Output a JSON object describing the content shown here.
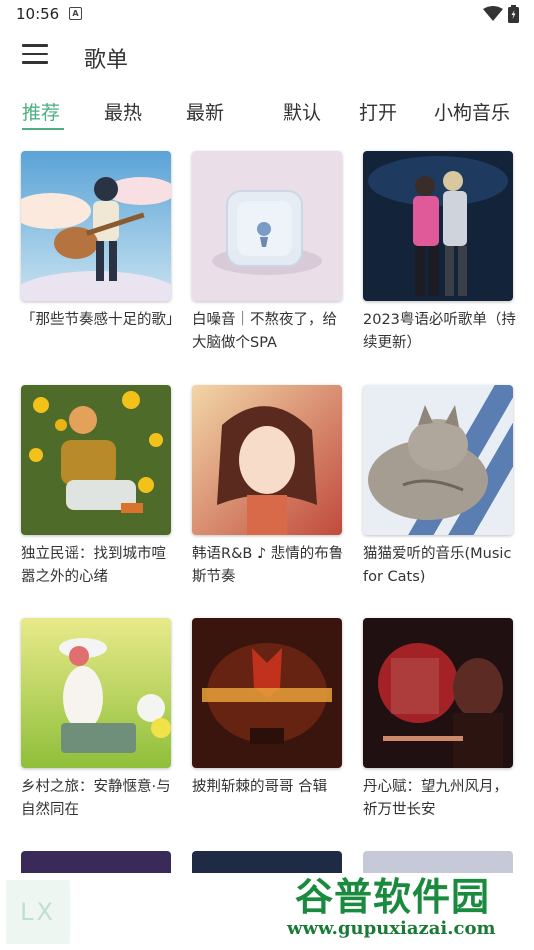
{
  "status": {
    "time": "10:56",
    "notif_icon": "A"
  },
  "header": {
    "title": "歌单"
  },
  "tabs": [
    {
      "label": "推荐"
    },
    {
      "label": "最热"
    },
    {
      "label": "最新"
    },
    {
      "label": "默认"
    },
    {
      "label": "打开"
    },
    {
      "label": "小枸音乐"
    }
  ],
  "playlists": [
    {
      "title": "「那些节奏感十足的歌」",
      "cover": "anime-guitar-girl"
    },
    {
      "title": "白噪音｜不熬夜了，给大脑做个SPA",
      "cover": "ice-cube"
    },
    {
      "title": "2023粤语必听歌单（持续更新）",
      "cover": "concert-stage"
    },
    {
      "title": "独立民谣：找到城市喧嚣之外的心绪",
      "cover": "girl-in-flowers"
    },
    {
      "title": "韩语R&B ♪ 悲情的布鲁斯节奏",
      "cover": "girl-portrait"
    },
    {
      "title": "猫猫爱听的音乐(Music for Cats)",
      "cover": "tabby-cat"
    },
    {
      "title": "乡村之旅：安静惬意·与自然同在",
      "cover": "girl-with-suitcase"
    },
    {
      "title": "披荆斩棘的哥哥 合辑",
      "cover": "show-poster"
    },
    {
      "title": "丹心赋：望九州风月，祈万世长安",
      "cover": "drama-poster"
    }
  ],
  "bottom": {
    "lx_badge": "LX"
  },
  "watermark": {
    "name": "谷普软件园",
    "url": "www.gupuxiazai.com"
  }
}
